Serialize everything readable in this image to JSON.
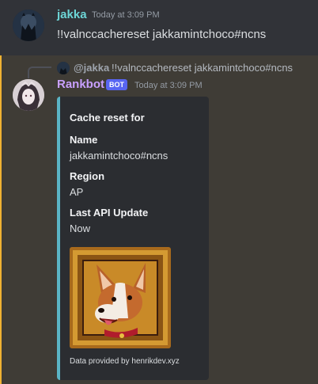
{
  "message1": {
    "author": "jakka",
    "timestamp": "Today at 3:09 PM",
    "content": "!!valnccachereset jakkamintchoco#ncns"
  },
  "message2": {
    "reply": {
      "mention": "@jakka",
      "content": "!!valnccachereset jakkamintchoco#ncns"
    },
    "author": "Rankbot",
    "badge": "BOT",
    "timestamp": "Today at 3:09 PM",
    "embed": {
      "author": "Cache reset for",
      "fields": [
        {
          "name": "Name",
          "value": "jakkamintchoco#ncns"
        },
        {
          "name": "Region",
          "value": "AP"
        },
        {
          "name": "Last API Update",
          "value": "Now"
        }
      ],
      "image_icon": "corgi-portrait",
      "footer": "Data provided by henrikdev.xyz"
    }
  },
  "colors": {
    "background": "#313338",
    "highlight_background": "#3f3c36",
    "highlight_bar": "#f0b232",
    "jakka_name": "#6dd6d7",
    "rankbot_name": "#c9a0ff",
    "bot_badge": "#5865f2",
    "embed_bg": "#2b2d31",
    "embed_border": "#5ab4c5"
  }
}
